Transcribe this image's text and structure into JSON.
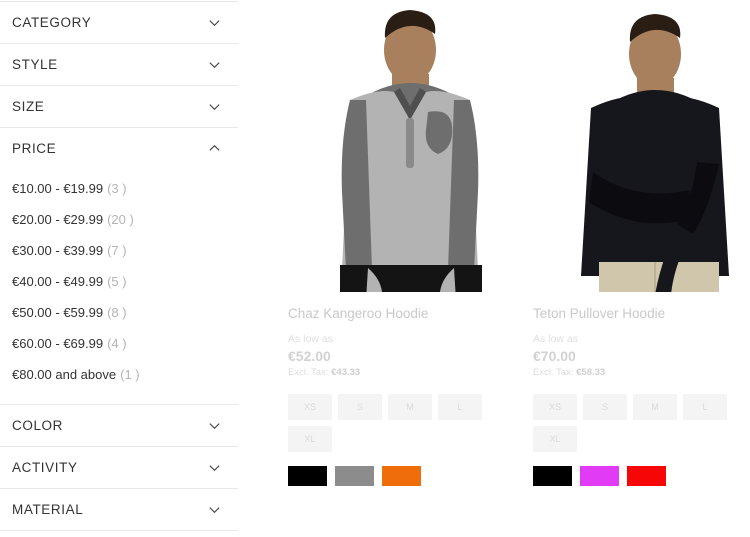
{
  "sidebar": {
    "filters": [
      {
        "label": "CATEGORY",
        "expanded": false,
        "icon": "chevron-down-icon"
      },
      {
        "label": "STYLE",
        "expanded": false,
        "icon": "chevron-down-icon"
      },
      {
        "label": "SIZE",
        "expanded": false,
        "icon": "chevron-down-icon"
      },
      {
        "label": "PRICE",
        "expanded": true,
        "icon": "chevron-up-icon"
      }
    ],
    "price_options": [
      {
        "range": "€10.00 - €19.99",
        "count": "(3 )"
      },
      {
        "range": "€20.00 - €29.99",
        "count": "(20 )"
      },
      {
        "range": "€30.00 - €39.99",
        "count": "(7 )"
      },
      {
        "range": "€40.00 - €49.99",
        "count": "(5 )"
      },
      {
        "range": "€50.00 - €59.99",
        "count": "(8 )"
      },
      {
        "range": "€60.00 - €69.99",
        "count": "(4 )"
      },
      {
        "range": "€80.00 and above",
        "count": "(1 )"
      }
    ],
    "filters_bottom": [
      {
        "label": "COLOR",
        "expanded": false,
        "icon": "chevron-down-icon"
      },
      {
        "label": "ACTIVITY",
        "expanded": false,
        "icon": "chevron-down-icon"
      },
      {
        "label": "MATERIAL",
        "expanded": false,
        "icon": "chevron-down-icon"
      }
    ]
  },
  "products": [
    {
      "name": "Chaz Kangeroo Hoodie",
      "as_low_as": "As low as",
      "price": "€52.00",
      "excl_tax_label": "Excl. Tax:",
      "excl_tax_value": "€43.33",
      "sizes": [
        "XS",
        "S",
        "M",
        "L",
        "XL"
      ],
      "colors": [
        "#000000",
        "#8c8c8c",
        "#ef6e0b"
      ],
      "image": {
        "hoodie_main": "#b3b3b3",
        "hoodie_shade": "#6e6e6e",
        "pants": "#141414",
        "skin": "#a8805e"
      }
    },
    {
      "name": "Teton Pullover Hoodie",
      "as_low_as": "As low as",
      "price": "€70.00",
      "excl_tax_label": "Excl. Tax:",
      "excl_tax_value": "€58.33",
      "sizes": [
        "XS",
        "S",
        "M",
        "L",
        "XL"
      ],
      "colors": [
        "#000000",
        "#e13bf5",
        "#f60606"
      ],
      "image": {
        "hoodie_main": "#16161d",
        "hoodie_shade": "#0b0b10",
        "pants": "#cfc6ac",
        "skin": "#a8805e"
      }
    }
  ]
}
